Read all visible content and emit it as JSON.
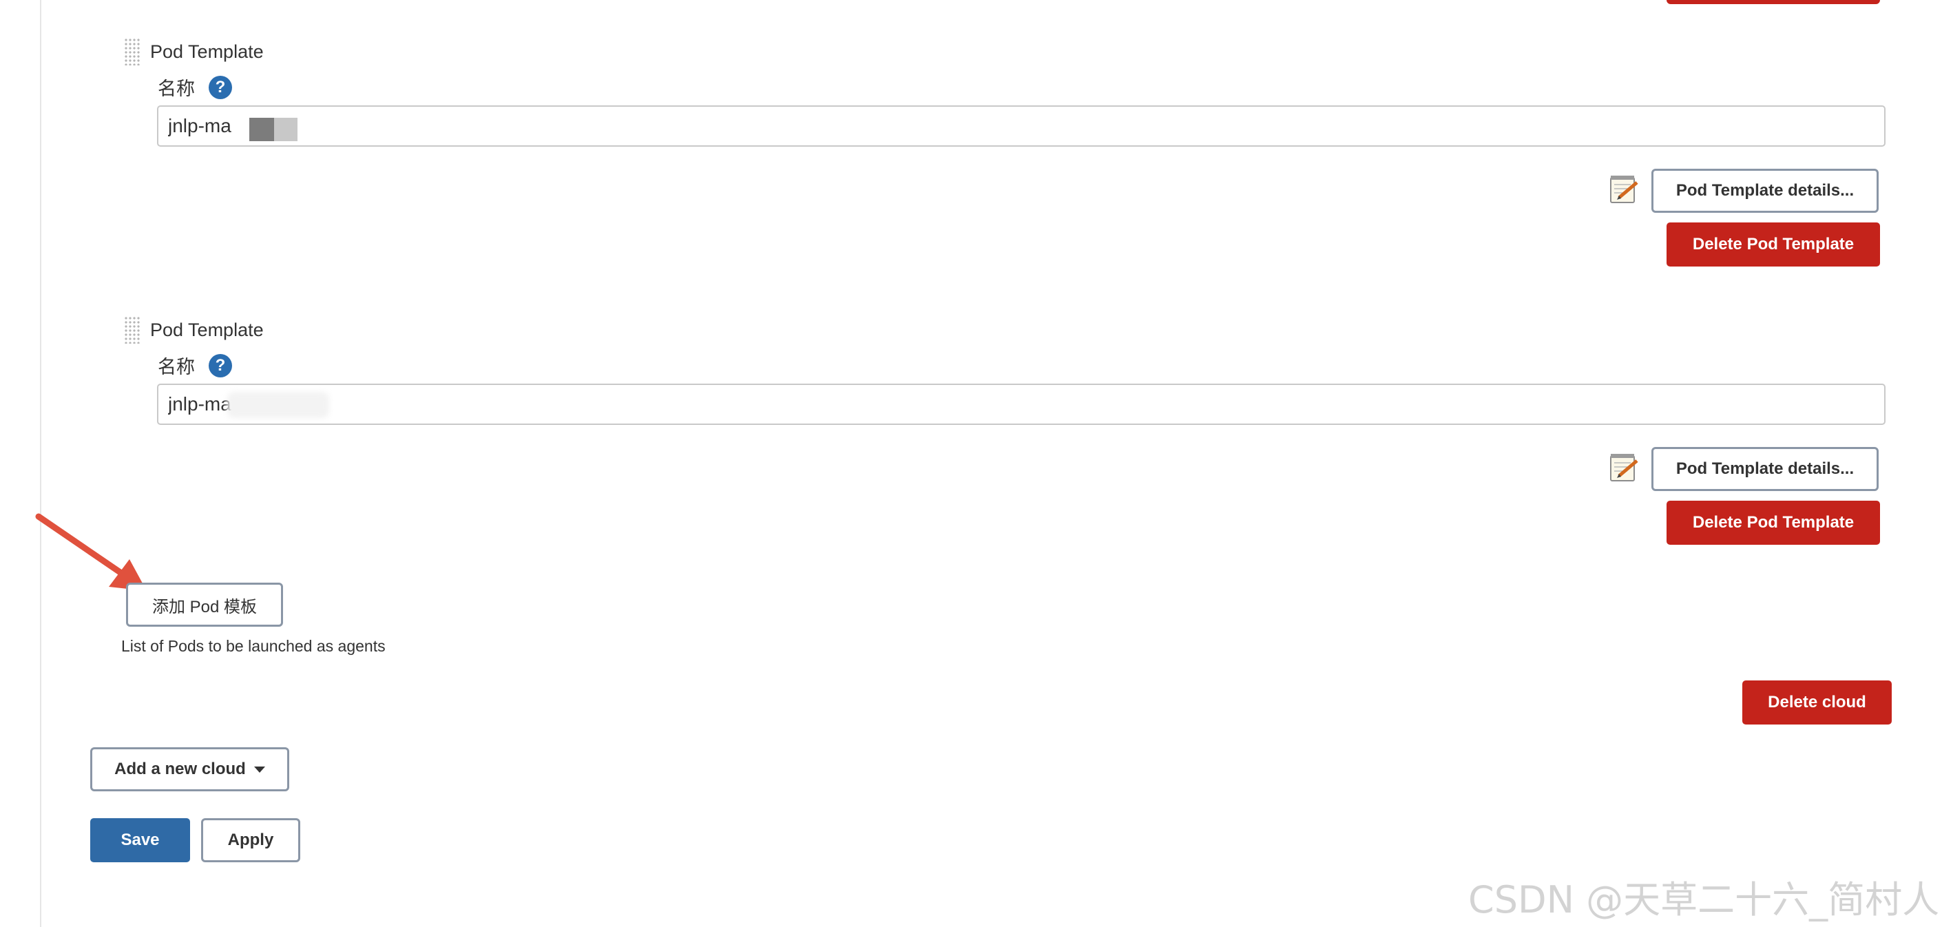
{
  "pod_templates": [
    {
      "header": "Pod Template",
      "name_label": "名称",
      "help_icon": "?",
      "name_value": "jnlp-ma",
      "details_label": "Pod Template details...",
      "delete_label": "Delete Pod Template"
    },
    {
      "header": "Pod Template",
      "name_label": "名称",
      "help_icon": "?",
      "name_value": "jnlp-ma",
      "details_label": "Pod Template details...",
      "delete_label": "Delete Pod Template"
    }
  ],
  "add_pod_template_label": "添加 Pod 模板",
  "pods_help_text": "List of Pods to be launched as agents",
  "delete_cloud_label": "Delete cloud",
  "add_cloud_label": "Add a new cloud",
  "save_label": "Save",
  "apply_label": "Apply",
  "watermark": "CSDN @天草二十六_简村人",
  "icons": {
    "drag": "drag-handle-icon",
    "help": "help-icon",
    "notepad": "notepad-pencil-icon",
    "dropdown": "caret-down-icon",
    "annotation": "red-arrow-icon"
  },
  "colors": {
    "danger": "#c4231b",
    "primary": "#2f6aa6",
    "help": "#2a6db0",
    "annotation_arrow": "#e0513d"
  }
}
